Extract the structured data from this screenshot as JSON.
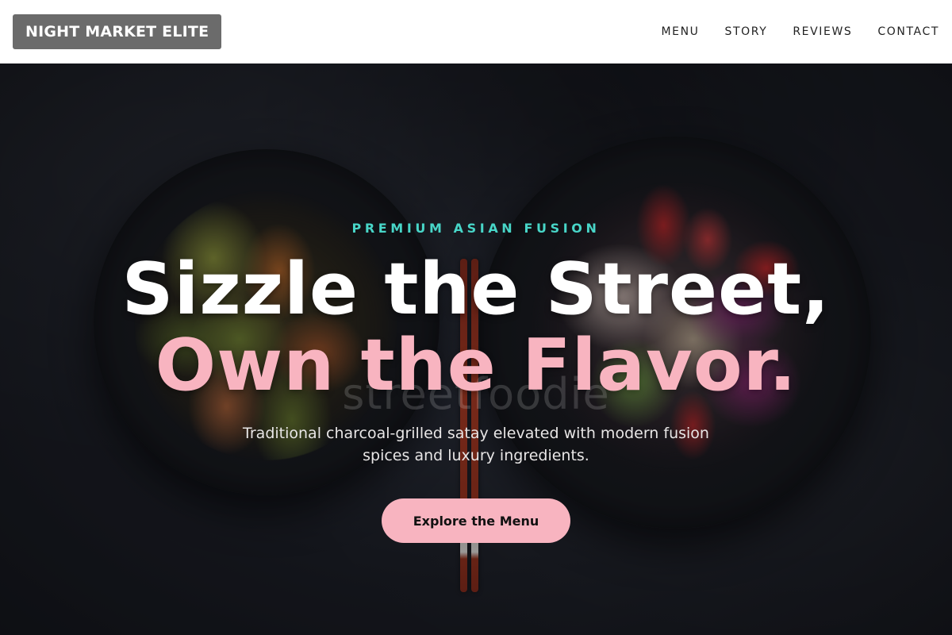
{
  "header": {
    "logo": "NIGHT MARKET ELITE",
    "nav": [
      {
        "label": "MENU"
      },
      {
        "label": "STORY"
      },
      {
        "label": "REVIEWS"
      },
      {
        "label": "CONTACT"
      }
    ]
  },
  "hero": {
    "eyebrow": "PREMIUM ASIAN FUSION",
    "headline_line1": "Sizzle the Street,",
    "headline_line2": "Own the Flavor.",
    "subtitle": "Traditional charcoal-grilled satay elevated with modern fusion spices and luxury ingredients.",
    "cta_label": "Explore the Menu",
    "watermark": "streetfoodie"
  },
  "colors": {
    "accent_pink": "#f8b4c0",
    "accent_teal": "#48d6c8",
    "logo_bg": "#6b6b6b"
  }
}
